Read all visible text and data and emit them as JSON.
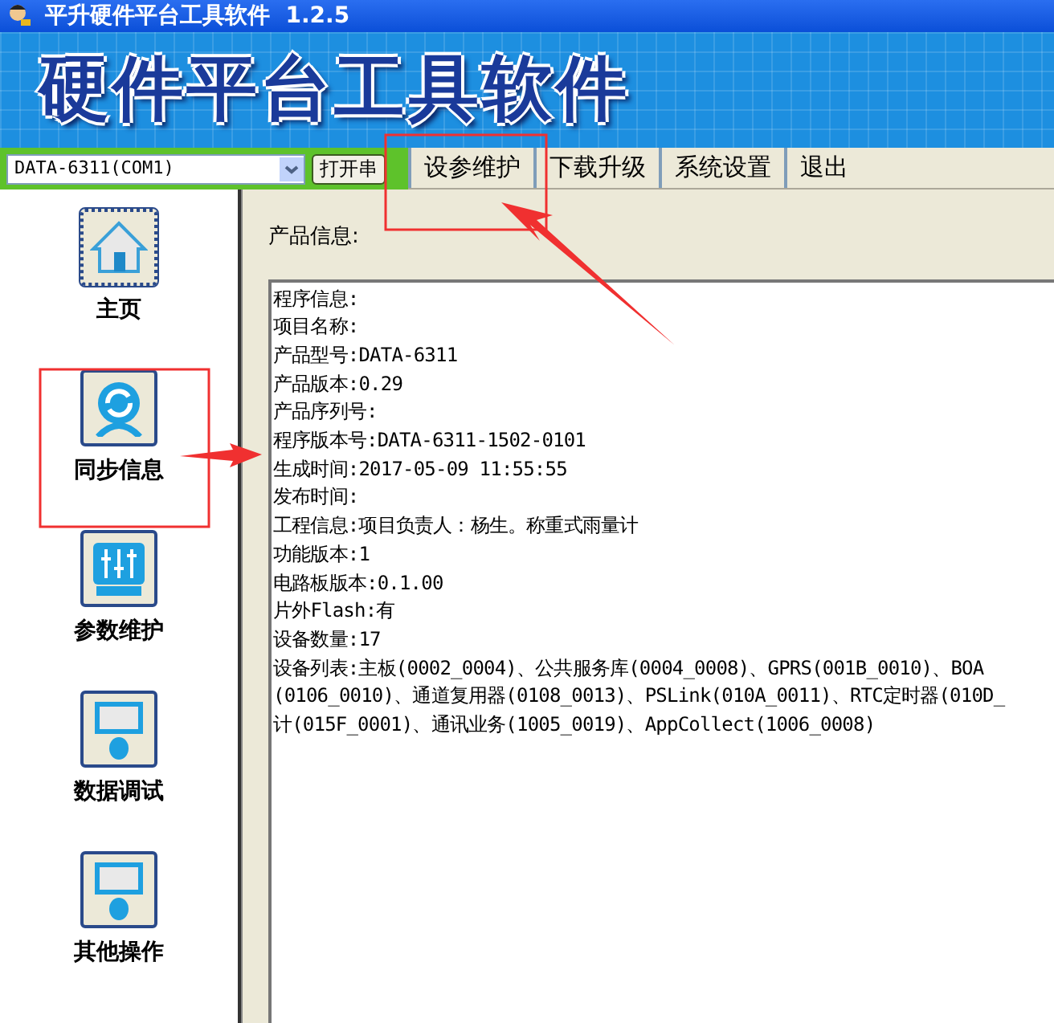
{
  "window": {
    "title": "平升硬件平台工具软件  1.2.5"
  },
  "banner": {
    "title": "硬件平台工具软件"
  },
  "toolbar": {
    "port": {
      "value": "DATA-6311(COM1)"
    },
    "open_button": "打开串",
    "menu": [
      {
        "label": "设参维护"
      },
      {
        "label": "下载升级"
      },
      {
        "label": "系统设置"
      },
      {
        "label": "退出"
      }
    ]
  },
  "sidebar": {
    "items": [
      {
        "label": "主页",
        "focused": true
      },
      {
        "label": "同步信息",
        "focused": false
      },
      {
        "label": "参数维护",
        "focused": false
      },
      {
        "label": "数据调试",
        "focused": false
      },
      {
        "label": "其他操作",
        "focused": false
      }
    ]
  },
  "content": {
    "heading": "产品信息:",
    "lines": [
      "程序信息:",
      "项目名称:",
      "产品型号:DATA-6311",
      "产品版本:0.29",
      "产品序列号:",
      "程序版本号:DATA-6311-1502-0101",
      "生成时间:2017-05-09 11:55:55",
      "发布时间:",
      "工程信息:项目负责人：杨生。称重式雨量计",
      "功能版本:1",
      "电路板版本:0.1.00",
      "片外Flash:有",
      "设备数量:17",
      "设备列表:主板(0002_0004)、公共服务库(0004_0008)、GPRS(001B_0010)、BOA",
      "(0106_0010)、通道复用器(0108_0013)、PSLink(010A_0011)、RTC定时器(010D_",
      "计(015F_0001)、通讯业务(1005_0019)、AppCollect(1006_0008)"
    ]
  }
}
